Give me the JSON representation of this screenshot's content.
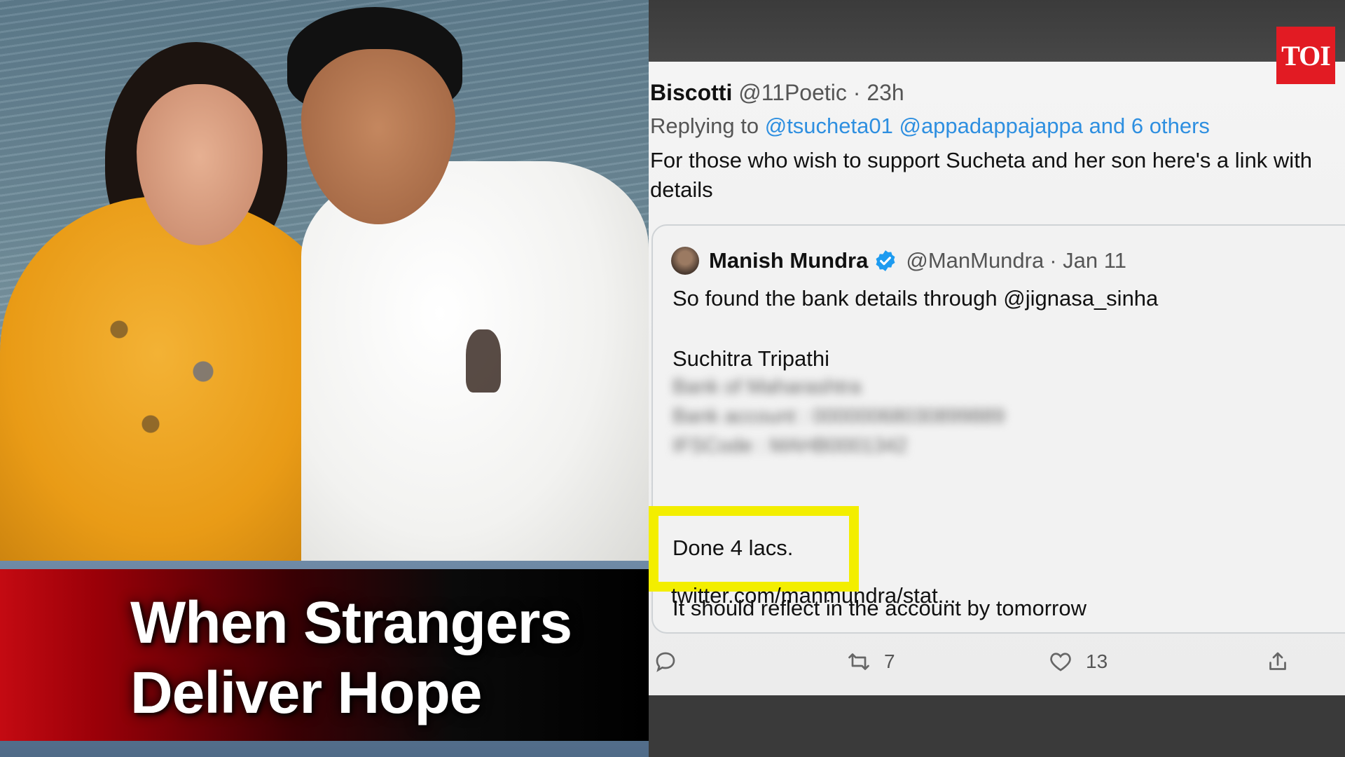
{
  "caption": {
    "line1": "When Strangers",
    "line2": "Deliver Hope"
  },
  "brand": {
    "logo_text": "TOI",
    "logo_color": "#e21b23"
  },
  "tweet": {
    "author_name": "Biscotti",
    "author_handle": "@11Poetic",
    "time": "· 23h",
    "replying_prefix": "Replying to",
    "replying_mentions": "@tsucheta01 @appadappajappa and 6 others",
    "body": "For those who wish to support Sucheta and her son  here's  a link with details",
    "quoted": {
      "author_name": "Manish Mundra",
      "author_handle": "@ManMundra",
      "time": "· Jan 11",
      "line1": "So found the bank details through @jignasa_sinha",
      "line2": "Suchitra Tripathi",
      "blur1": "Bank of Maharashtra",
      "blur2": "Bank account : 00000068030899889",
      "blur3": "IFSCode : MAHB0001342",
      "highlight": "Done 4 lacs.",
      "line3": "It should reflect in the account by tomorrow",
      "line4": "twitter.com/manmundra/stat..."
    },
    "actions": {
      "retweet_count": "7",
      "like_count": "13"
    },
    "highlight_color": "#f3ee00",
    "mention_color": "#2e8fe0"
  }
}
